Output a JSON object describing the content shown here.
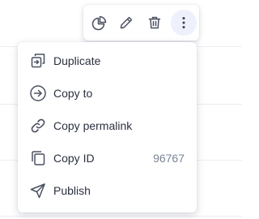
{
  "colors": {
    "icon": "#4a5060",
    "text": "#2b3040",
    "muted": "#7a8496",
    "active_bg": "#eef0fb"
  },
  "toolbar": {
    "buttons": [
      {
        "icon": "pie-chart-icon"
      },
      {
        "icon": "pencil-icon"
      },
      {
        "icon": "trash-icon"
      },
      {
        "icon": "more-vertical-icon",
        "active": true
      }
    ]
  },
  "menu": {
    "items": [
      {
        "label": "Duplicate",
        "icon": "duplicate-icon"
      },
      {
        "label": "Copy to",
        "icon": "arrow-right-circle-icon"
      },
      {
        "label": "Copy permalink",
        "icon": "link-icon"
      },
      {
        "label": "Copy ID",
        "icon": "copy-icon",
        "meta": "96767"
      },
      {
        "label": "Publish",
        "icon": "send-icon"
      }
    ]
  }
}
